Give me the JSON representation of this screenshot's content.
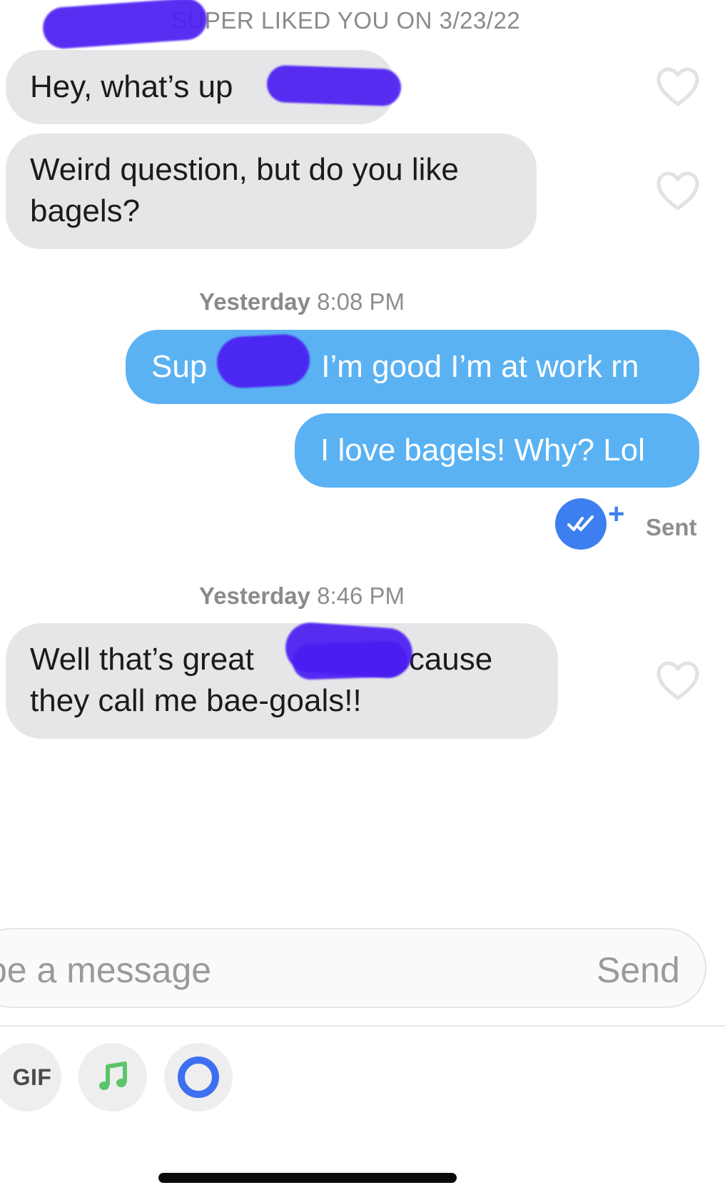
{
  "conversation": {
    "header_note": "SUPER LIKED YOU ON 3/23/22",
    "messages": [
      {
        "direction": "incoming",
        "text": "Hey, what’s up"
      },
      {
        "direction": "incoming",
        "line1": "Weird question, but do you like",
        "line2": "bagels?"
      },
      {
        "direction": "outgoing",
        "prefix": "Sup",
        "suffix": "I’m good I’m at work rn"
      },
      {
        "direction": "outgoing",
        "text": "I love bagels! Why? Lol"
      },
      {
        "direction": "incoming",
        "line1_prefix": "Well that’s great",
        "line1_suffix": "because",
        "line2": "they call me bae-goals!!"
      }
    ],
    "timestamps": [
      {
        "day": "Yesterday",
        "time": "8:08 PM"
      },
      {
        "day": "Yesterday",
        "time": "8:46 PM"
      }
    ],
    "status": {
      "label": "Sent",
      "plus": "+"
    },
    "redaction_color": "#4a1df2"
  },
  "composer": {
    "placeholder": "pe a message",
    "send_label": "Send",
    "tools": [
      {
        "name": "gif",
        "label": "GIF"
      },
      {
        "name": "music",
        "icon": "music-note-icon",
        "color": "#5cc46a"
      },
      {
        "name": "loop",
        "icon": "ring-icon",
        "color": "#3d6ff0"
      }
    ]
  },
  "colors": {
    "outgoing_bubble": "#5ab2f3",
    "incoming_bubble": "#e6e6e8",
    "accent_blue": "#3d7ff0"
  }
}
